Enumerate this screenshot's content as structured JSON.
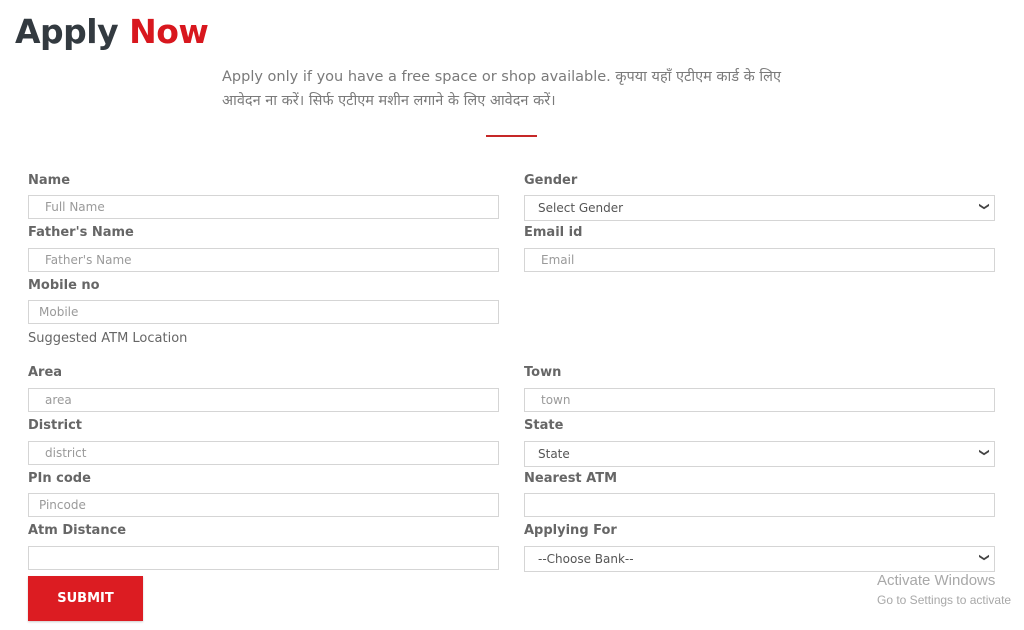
{
  "header": {
    "title_part1": "Apply",
    "title_part2": "Now",
    "accent_color": "#d8171e",
    "intro": "Apply only if you have a free space or shop available. कृपया यहाँ एटीएम कार्ड के लिए आवेदन ना करें। सिर्फ एटीएम मशीन लगाने के लिए आवेदन करें।"
  },
  "form": {
    "name": {
      "label": "Name",
      "placeholder": "Full Name"
    },
    "gender": {
      "label": "Gender",
      "selected": "Select Gender"
    },
    "father_name": {
      "label": "Father's Name",
      "placeholder": "Father's Name"
    },
    "email": {
      "label": "Email id",
      "placeholder": "Email"
    },
    "mobile": {
      "label": "Mobile no",
      "placeholder": "Mobile"
    },
    "section_label": "Suggested ATM Location",
    "area": {
      "label": "Area",
      "placeholder": "area"
    },
    "town": {
      "label": "Town",
      "placeholder": "town"
    },
    "district": {
      "label": "District",
      "placeholder": "district"
    },
    "state": {
      "label": "State",
      "selected": "State"
    },
    "pincode": {
      "label": "PIn code",
      "placeholder": "Pincode"
    },
    "nearest_atm": {
      "label": "Nearest ATM",
      "placeholder": ""
    },
    "atm_distance": {
      "label": "Atm Distance",
      "placeholder": ""
    },
    "applying_for": {
      "label": "Applying For",
      "selected": "--Choose Bank--"
    },
    "submit_label": "SUBMIT"
  },
  "watermark": {
    "line1": "Activate Windows",
    "line2": "Go to Settings to activate"
  }
}
